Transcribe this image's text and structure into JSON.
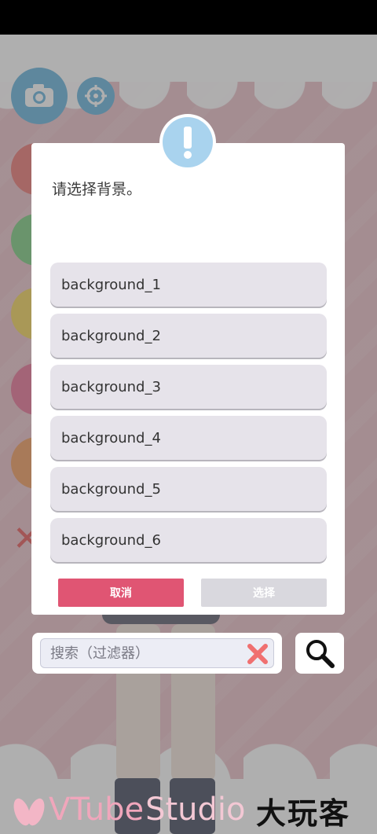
{
  "dialog": {
    "prompt": "请选择背景。",
    "backgrounds": [
      {
        "label": "background_1"
      },
      {
        "label": "background_2"
      },
      {
        "label": "background_3"
      },
      {
        "label": "background_4"
      },
      {
        "label": "background_5"
      },
      {
        "label": "background_6"
      }
    ],
    "cancel_label": "取消",
    "select_label": "选择"
  },
  "search": {
    "placeholder": "搜索（过滤器）",
    "value": ""
  },
  "watermark": {
    "vtube_part1": "VTube",
    "vtube_part2": "Studio",
    "site": "大玩客"
  },
  "colors": {
    "accent_pink": "#e05573",
    "alert_blue": "#a9d3ee",
    "disabled_gray": "#d9d8de",
    "clear_red": "#f07070"
  }
}
